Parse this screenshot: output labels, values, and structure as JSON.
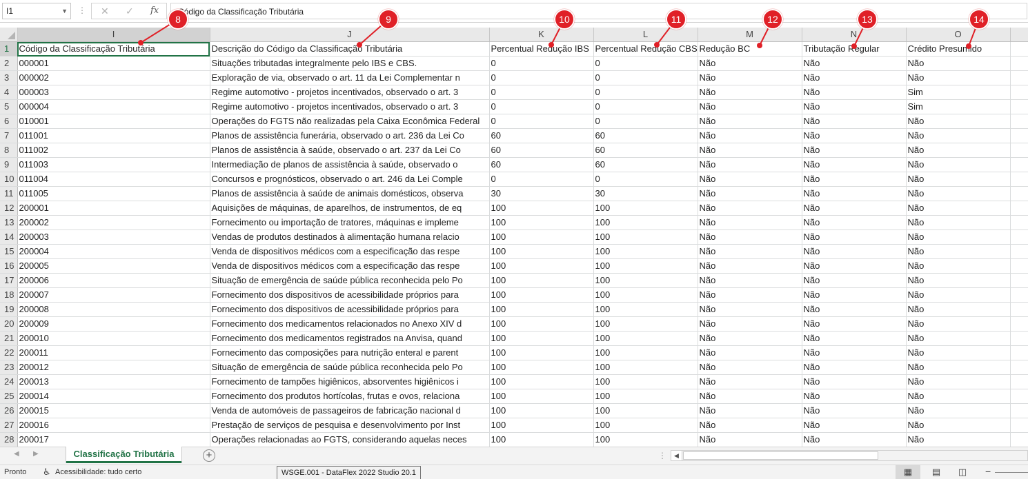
{
  "formula_bar": {
    "name_box": "I1",
    "formula": "Código da Classificação Tributária"
  },
  "columns": [
    "I",
    "J",
    "K",
    "L",
    "M",
    "N",
    "O"
  ],
  "rows": [
    {
      "n": "1",
      "cells": [
        "Código da Classificação Tributária",
        "Descrição do Código da Classificação Tributária",
        "Percentual Redução IBS",
        "Percentual Redução CBS",
        "Redução BC",
        "Tributação Regular",
        "Crédito Presumido"
      ]
    },
    {
      "n": "2",
      "cells": [
        "000001",
        "Situações tributadas integralmente pelo IBS e CBS.",
        "0",
        "0",
        "Não",
        "Não",
        "Não"
      ]
    },
    {
      "n": "3",
      "cells": [
        "000002",
        "Exploração de via, observado o art. 11 da Lei Complementar n",
        "0",
        "0",
        "Não",
        "Não",
        "Não"
      ]
    },
    {
      "n": "4",
      "cells": [
        "000003",
        "Regime automotivo - projetos incentivados, observado o art. 3",
        "0",
        "0",
        "Não",
        "Não",
        "Sim"
      ]
    },
    {
      "n": "5",
      "cells": [
        "000004",
        "Regime automotivo - projetos incentivados, observado o art. 3",
        "0",
        "0",
        "Não",
        "Não",
        "Sim"
      ]
    },
    {
      "n": "6",
      "cells": [
        "010001",
        "Operações do FGTS não realizadas pela Caixa Econômica Federal",
        "0",
        "0",
        "Não",
        "Não",
        "Não"
      ]
    },
    {
      "n": "7",
      "cells": [
        "011001",
        "Planos de assistência funerária, observado o art. 236 da Lei Co",
        "60",
        "60",
        "Não",
        "Não",
        "Não"
      ]
    },
    {
      "n": "8",
      "cells": [
        "011002",
        "Planos de assistência à saúde, observado o art. 237 da Lei Co",
        "60",
        "60",
        "Não",
        "Não",
        "Não"
      ]
    },
    {
      "n": "9",
      "cells": [
        "011003",
        "Intermediação de planos de assistência à saúde, observado o",
        "60",
        "60",
        "Não",
        "Não",
        "Não"
      ]
    },
    {
      "n": "10",
      "cells": [
        "011004",
        "Concursos e prognósticos, observado o art. 246 da Lei Comple",
        "0",
        "0",
        "Não",
        "Não",
        "Não"
      ]
    },
    {
      "n": "11",
      "cells": [
        "011005",
        "Planos de assistência à saúde de animais domésticos, observa",
        "30",
        "30",
        "Não",
        "Não",
        "Não"
      ]
    },
    {
      "n": "12",
      "cells": [
        "200001",
        "Aquisições de máquinas, de aparelhos, de instrumentos, de eq",
        "100",
        "100",
        "Não",
        "Não",
        "Não"
      ]
    },
    {
      "n": "13",
      "cells": [
        "200002",
        "Fornecimento ou importação de tratores, máquinas e impleme",
        "100",
        "100",
        "Não",
        "Não",
        "Não"
      ]
    },
    {
      "n": "14",
      "cells": [
        "200003",
        "Vendas de produtos destinados à alimentação humana relacio",
        "100",
        "100",
        "Não",
        "Não",
        "Não"
      ]
    },
    {
      "n": "15",
      "cells": [
        "200004",
        "Venda de dispositivos médicos com a especificação das respe",
        "100",
        "100",
        "Não",
        "Não",
        "Não"
      ]
    },
    {
      "n": "16",
      "cells": [
        "200005",
        "Venda de dispositivos médicos com a especificação das respe",
        "100",
        "100",
        "Não",
        "Não",
        "Não"
      ]
    },
    {
      "n": "17",
      "cells": [
        "200006",
        "Situação de emergência de saúde pública reconhecida pelo Po",
        "100",
        "100",
        "Não",
        "Não",
        "Não"
      ]
    },
    {
      "n": "18",
      "cells": [
        "200007",
        "Fornecimento dos dispositivos de acessibilidade próprios para",
        "100",
        "100",
        "Não",
        "Não",
        "Não"
      ]
    },
    {
      "n": "19",
      "cells": [
        "200008",
        "Fornecimento dos dispositivos de acessibilidade próprios para",
        "100",
        "100",
        "Não",
        "Não",
        "Não"
      ]
    },
    {
      "n": "20",
      "cells": [
        "200009",
        "Fornecimento dos medicamentos relacionados no Anexo XIV d",
        "100",
        "100",
        "Não",
        "Não",
        "Não"
      ]
    },
    {
      "n": "21",
      "cells": [
        "200010",
        "Fornecimento dos medicamentos registrados na Anvisa, quand",
        "100",
        "100",
        "Não",
        "Não",
        "Não"
      ]
    },
    {
      "n": "22",
      "cells": [
        "200011",
        "Fornecimento das composições para nutrição enteral e parent",
        "100",
        "100",
        "Não",
        "Não",
        "Não"
      ]
    },
    {
      "n": "23",
      "cells": [
        "200012",
        "Situação de emergência de saúde pública reconhecida pelo Po",
        "100",
        "100",
        "Não",
        "Não",
        "Não"
      ]
    },
    {
      "n": "24",
      "cells": [
        "200013",
        "Fornecimento de tampões higiênicos, absorventes higiênicos i",
        "100",
        "100",
        "Não",
        "Não",
        "Não"
      ]
    },
    {
      "n": "25",
      "cells": [
        "200014",
        "Fornecimento dos produtos hortícolas, frutas e ovos, relaciona",
        "100",
        "100",
        "Não",
        "Não",
        "Não"
      ]
    },
    {
      "n": "26",
      "cells": [
        "200015",
        "Venda de automóveis de passageiros de fabricação nacional d",
        "100",
        "100",
        "Não",
        "Não",
        "Não"
      ]
    },
    {
      "n": "27",
      "cells": [
        "200016",
        "Prestação de serviços de pesquisa e desenvolvimento por Inst",
        "100",
        "100",
        "Não",
        "Não",
        "Não"
      ]
    },
    {
      "n": "28",
      "cells": [
        "200017",
        "Operações relacionadas ao FGTS, considerando aquelas neces",
        "100",
        "100",
        "Não",
        "Não",
        "Não"
      ]
    }
  ],
  "markers": [
    "8",
    "9",
    "10",
    "11",
    "12",
    "13",
    "14"
  ],
  "sheet_tab": "Classificação Tributária",
  "status": {
    "ready": "Pronto",
    "accessibility": "Acessibilidade: tudo certo",
    "tooltip": "WSGE.001 - DataFlex 2022 Studio 20.1"
  },
  "colors": {
    "excel_green": "#217346",
    "marker_red": "#e02027",
    "header_gray": "#e9e9e9"
  },
  "icons": [
    "name-box-dropdown-icon",
    "cancel-icon",
    "enter-icon",
    "fx-icon",
    "select-all-icon",
    "add-sheet-icon",
    "accessibility-icon",
    "normal-view-icon",
    "page-layout-icon",
    "page-break-icon",
    "zoom-out-icon"
  ]
}
